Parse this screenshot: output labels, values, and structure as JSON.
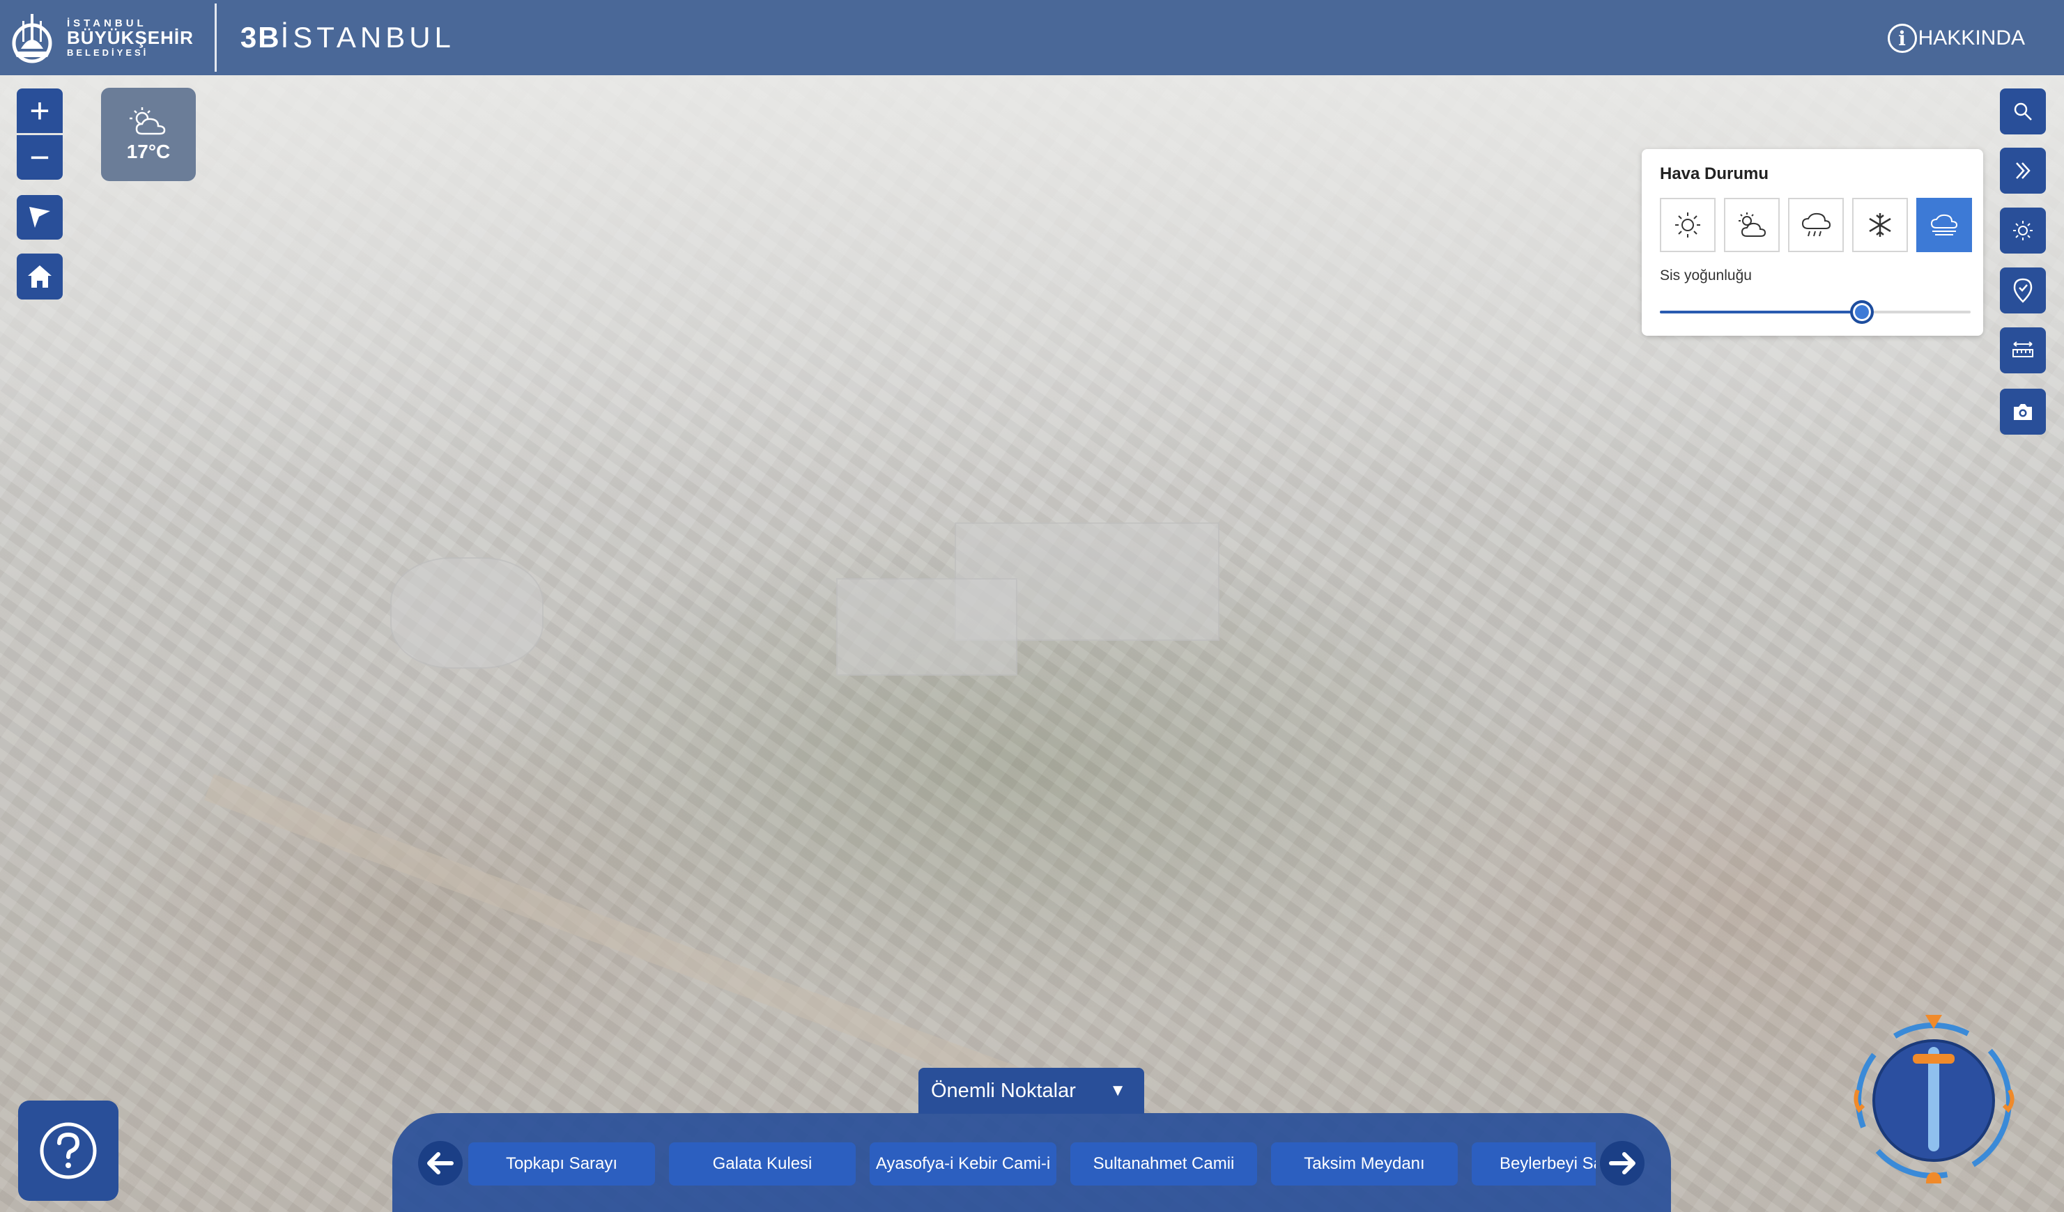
{
  "header": {
    "logo": {
      "line1": "İSTANBUL",
      "line2": "BÜYÜKŞEHİR",
      "line3": "BELEDİYESİ"
    },
    "app_title_bold": "3B",
    "app_title_rest": "İSTANBUL",
    "about_label": "HAKKINDA"
  },
  "map_controls": {
    "zoom_in": "+",
    "zoom_out": "−",
    "locate_icon": "navigation-arrow-icon",
    "home_icon": "home-icon"
  },
  "weather_badge": {
    "temperature": "17°C",
    "icon": "partly-cloudy-icon"
  },
  "right_toolbar": [
    "search-icon",
    "double-chevron-icon",
    "sun-icon",
    "location-pin-icon",
    "measure-icon",
    "camera-icon"
  ],
  "weather_panel": {
    "title": "Hava Durumu",
    "options": [
      {
        "name": "sunny",
        "icon": "sun-icon",
        "active": false
      },
      {
        "name": "partly-cloudy",
        "icon": "partly-cloudy-icon",
        "active": false
      },
      {
        "name": "rain",
        "icon": "rain-icon",
        "active": false
      },
      {
        "name": "snow",
        "icon": "snowflake-icon",
        "active": false
      },
      {
        "name": "fog",
        "icon": "fog-icon",
        "active": true
      }
    ],
    "slider_label": "Sis yoğunluğu",
    "slider_value": 0.65
  },
  "poi": {
    "tab_label": "Önemli Noktalar",
    "tab_arrow": "▼",
    "items": [
      "Topkapı Sarayı",
      "Galata Kulesi",
      "Ayasofya-i Kebir Cami-i",
      "Sultanahmet Camii",
      "Taksim Meydanı",
      "Beylerbeyi Sarayı"
    ]
  },
  "colors": {
    "header": "#4a6898",
    "button": "#294f99",
    "active_option": "#3d7ad6",
    "compass_accent": "#f08a2a"
  }
}
